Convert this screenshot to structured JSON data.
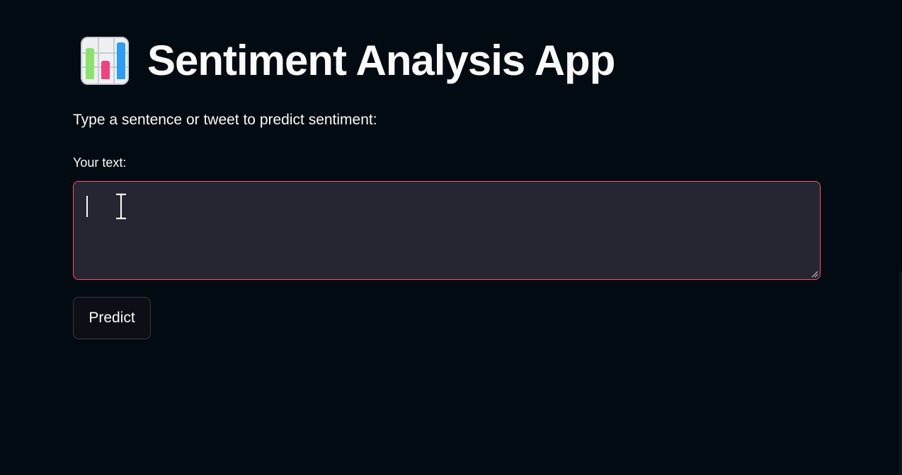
{
  "header": {
    "icon": "bar-chart-icon",
    "title": "Sentiment Analysis App"
  },
  "instructions": "Type a sentence or tweet to predict sentiment:",
  "input": {
    "label": "Your text:",
    "value": "",
    "placeholder": ""
  },
  "actions": {
    "predict_label": "Predict"
  },
  "colors": {
    "background": "#020b11",
    "text": "#fafafa",
    "input_background": "#262633",
    "input_focus_border": "#ff4b6b",
    "button_background": "#0e0f16",
    "chart_icon_bars": [
      "#8be36b",
      "#f0437d",
      "#2d9df3"
    ]
  }
}
